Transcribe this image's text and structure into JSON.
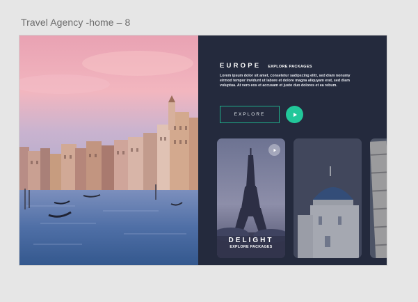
{
  "artboard": {
    "label": "Travel Agency -home – 8"
  },
  "hero": {
    "alt": "Venice grand canal at sunset"
  },
  "panel": {
    "title": "EUROPE",
    "subtitle": "EXPLORE PACKAGES",
    "description": "Lorem ipsum dolor sit amet, consetetur sadipscing elitr, sed diam nonumy eirmod tempor invidunt ut labore et dolore magna aliquyam erat, sed diam voluptua. At vero eos et accusam et justo duo dolores et ea rebum.",
    "explore_label": "EXPLORE"
  },
  "cards": [
    {
      "title": "DELIGHT",
      "subtitle": "EXPLORE PACKAGES",
      "image": "eiffel-tower"
    },
    {
      "image": "santorini-dome"
    },
    {
      "image": "leaning-tower"
    }
  ],
  "colors": {
    "panel_bg": "#242a3d",
    "accent": "#22c79a",
    "accent_border": "#1fae8a"
  },
  "icons": [
    "play-icon"
  ]
}
